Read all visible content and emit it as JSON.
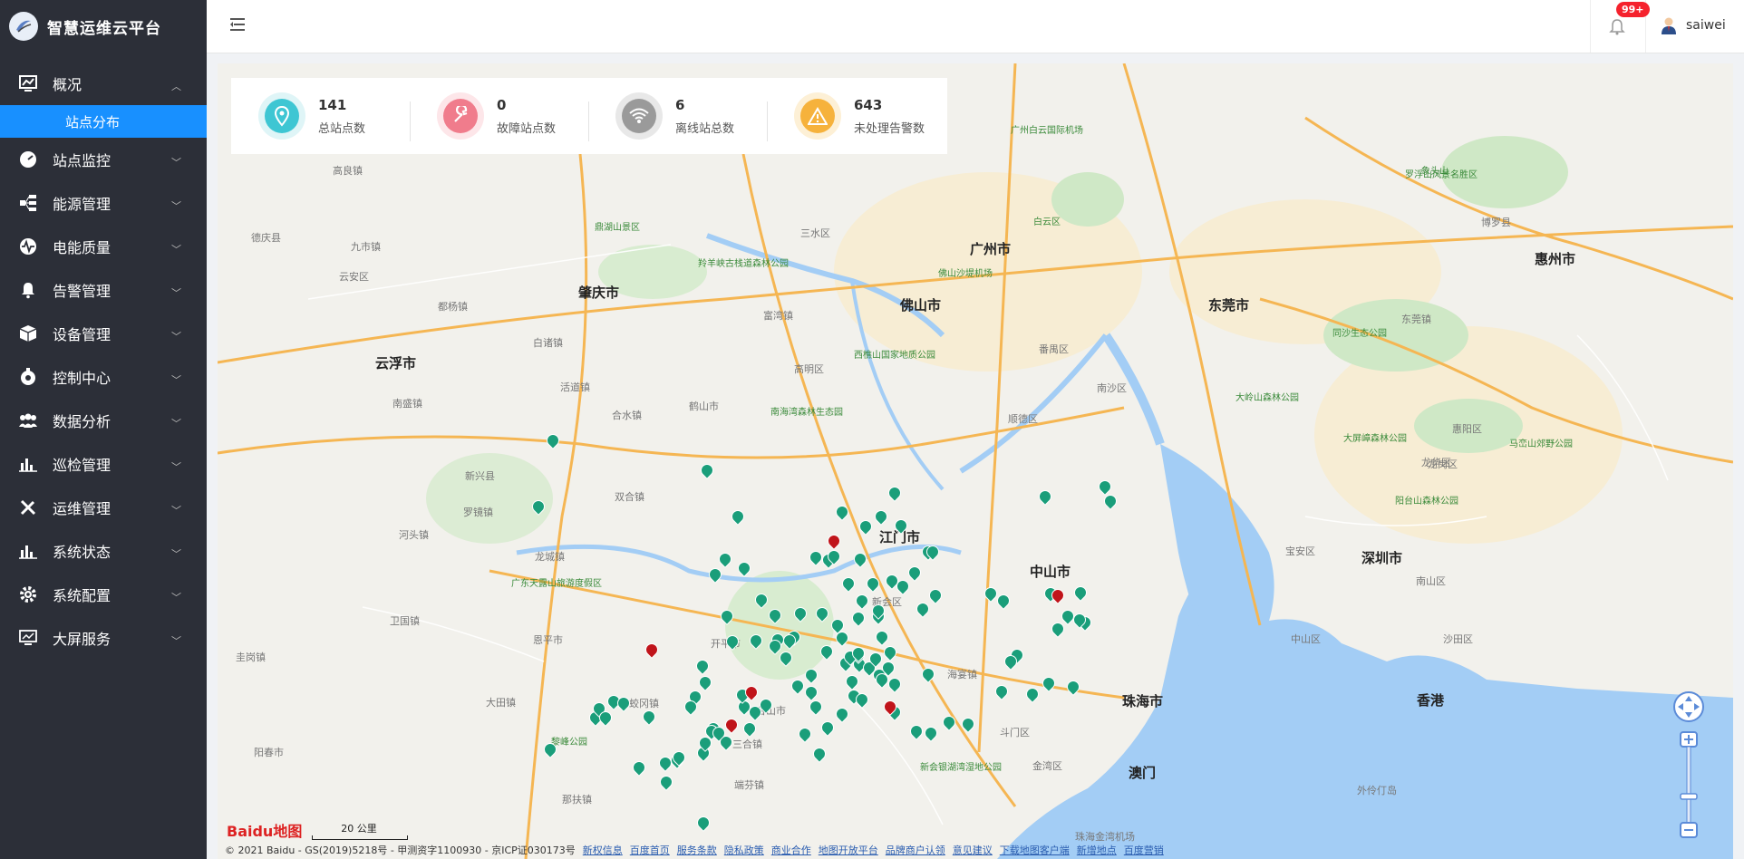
{
  "app": {
    "title": "智慧运维云平台"
  },
  "sidebar": {
    "items": [
      {
        "label": "概况",
        "icon": "dashboard-icon",
        "expanded": true
      },
      {
        "label": "站点监控",
        "icon": "gauge-icon"
      },
      {
        "label": "能源管理",
        "icon": "energy-icon"
      },
      {
        "label": "电能质量",
        "icon": "wave-icon"
      },
      {
        "label": "告警管理",
        "icon": "alarm-icon"
      },
      {
        "label": "设备管理",
        "icon": "cube-icon"
      },
      {
        "label": "控制中心",
        "icon": "control-icon"
      },
      {
        "label": "数据分析",
        "icon": "people-icon"
      },
      {
        "label": "巡检管理",
        "icon": "bar-chart-icon"
      },
      {
        "label": "运维管理",
        "icon": "tools-icon"
      },
      {
        "label": "系统状态",
        "icon": "bar-chart-icon"
      },
      {
        "label": "系统配置",
        "icon": "gear-icon"
      },
      {
        "label": "大屏服务",
        "icon": "monitor-icon"
      }
    ],
    "sub_item": "站点分布"
  },
  "header": {
    "badge": "99+",
    "username": "saiwei"
  },
  "stats": [
    {
      "value": "141",
      "label": "总站点数",
      "color": "#3ec6d3",
      "bg": "#dff5f7",
      "icon": "location-icon"
    },
    {
      "value": "0",
      "label": "故障站点数",
      "color": "#f07c8c",
      "bg": "#fde6e9",
      "icon": "wrench-icon"
    },
    {
      "value": "6",
      "label": "离线站总数",
      "color": "#9a9a9a",
      "bg": "#e8e8e8",
      "icon": "wifi-icon"
    },
    {
      "value": "643",
      "label": "未处理告警数",
      "color": "#f6b23c",
      "bg": "#fdf0d6",
      "icon": "warning-icon"
    }
  ],
  "map": {
    "cities": [
      "广州市",
      "佛山市",
      "肇庆市",
      "云浮市",
      "江门市",
      "中山市",
      "东莞市",
      "惠州市",
      "深圳市",
      "珠海市",
      "澳门",
      "香港"
    ],
    "towns": [
      "德庆县",
      "九市镇",
      "云安区",
      "都杨镇",
      "高良镇",
      "南盛镇",
      "新兴县",
      "罗镜镇",
      "双合镇",
      "合水镇",
      "白诸镇",
      "活道镇",
      "富湾镇",
      "三水区",
      "高明区",
      "番禺区",
      "南沙区",
      "顺德区",
      "开平市",
      "鹤山市",
      "台山市",
      "斗门区",
      "金湾区",
      "新会区",
      "阳春市",
      "恩平市",
      "大田镇",
      "河头镇",
      "卫国镇",
      "圭岗镇",
      "龙城镇",
      "宝安区",
      "龙岗区",
      "龙华区",
      "南山区",
      "博罗县",
      "惠阳区",
      "东莞镇",
      "三合镇",
      "端芬镇",
      "那扶镇",
      "蛟冈镇",
      "中山区",
      "沙田区",
      "海宴镇",
      "珠海金湾机场",
      "外伶仃岛"
    ],
    "parks": [
      "鼎湖山景区",
      "羚羊峡古栈道森林公园",
      "西樵山国家地质公园",
      "南海湾森林生态园",
      "广东天露山旅游度假区",
      "罗浮山风景名胜区",
      "白云区",
      "黎峰公园",
      "大岭山森林公园",
      "大屏嶂森林公园",
      "阳台山森林公园",
      "同沙生态公园",
      "马峦山郊野公园",
      "新会银湖湾湿地公园",
      "象头山",
      "佛山沙堤机场",
      "广州白云国际机场"
    ],
    "copyright": "© 2021 Baidu - GS(2019)5218号 - 甲测资字1100930 - 京ICP证030173号",
    "links": [
      "新权信息",
      "百度首页",
      "服务条款",
      "隐私政策",
      "商业合作",
      "地图开放平台",
      "品牌商户认领",
      "意见建议",
      "下载地图客户端",
      "新增地点",
      "百度营销"
    ],
    "scale_label": "20 公里",
    "logo_text": "Baidu地图"
  }
}
